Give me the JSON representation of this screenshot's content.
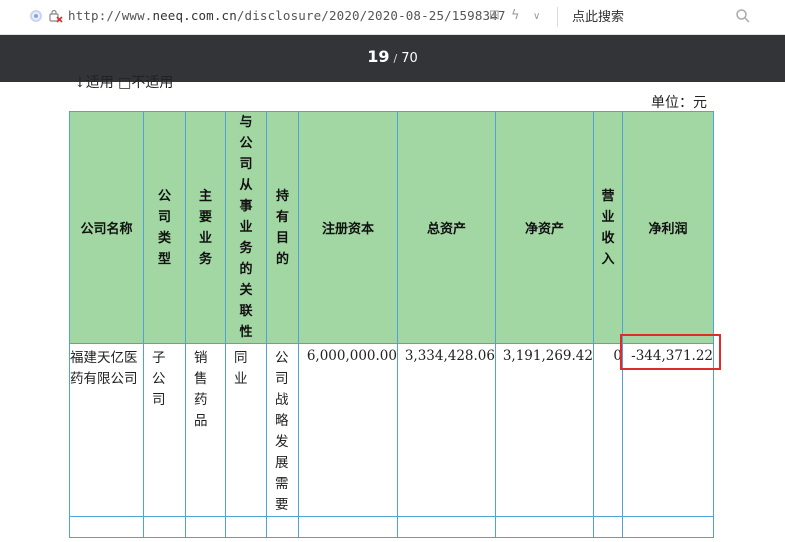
{
  "browser": {
    "url_prefix": "http://www.",
    "url_host": "neeq.com.cn",
    "url_path": "/disclosure/2020/2020-08-25/1598347",
    "search_placeholder": "点此搜索"
  },
  "pdf_toolbar": {
    "current_page": "19",
    "separator": "/",
    "total_pages": "70"
  },
  "document": {
    "partial_heading": "↓适用 □不适用",
    "unit_label": "单位：元",
    "table": {
      "headers": [
        "公司名称",
        "公司类型",
        "主要业务",
        "与公司从事业务的关联性",
        "持有目的",
        "注册资本",
        "总资产",
        "净资产",
        "营业收入",
        "净利润"
      ],
      "rows": [
        {
          "company_name": "福建天亿医药有限公司",
          "company_type": "子公司",
          "main_business": "销售药品",
          "relation": "同业",
          "purpose": "公司战略发展需要",
          "registered_capital": "6,000,000.00",
          "total_assets": "3,334,428.06",
          "net_assets": "3,191,269.42",
          "revenue": "0",
          "net_profit": "-344,371.22"
        }
      ]
    }
  },
  "colors": {
    "header_bg": "#a2d6a2",
    "border": "#4fa3d8",
    "highlight": "#e02b2b",
    "pdf_toolbar": "#333438"
  }
}
